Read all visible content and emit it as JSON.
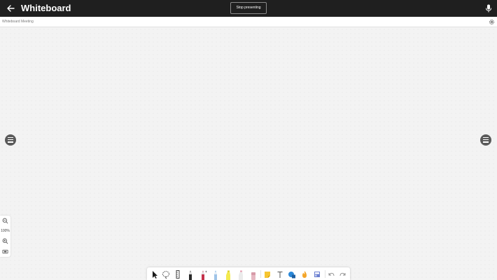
{
  "app": {
    "title": "Whiteboard",
    "stop_presenting_label": "Stop presenting",
    "meeting_name": "Whiteboard Meeting"
  },
  "zoom": {
    "level": "100%"
  },
  "icons": {
    "back": "arrow-left-icon",
    "mic": "microphone-icon",
    "settings": "gear-icon",
    "side_menu": "hamburger-menu-icon",
    "zoom_out": "zoom-out-icon",
    "zoom_in": "zoom-in-icon",
    "fit_view": "fit-to-screen-icon"
  },
  "toolbar": {
    "tools": [
      "select",
      "lasso",
      "ruler",
      "black-pen",
      "red-pen",
      "blue-pen",
      "yellow-highlighter",
      "pink-highlighter",
      "eraser",
      "sticky-note",
      "text",
      "shapes",
      "reactions",
      "templates",
      "undo",
      "redo"
    ]
  },
  "colors": {
    "topbar": "#1f1f1f",
    "canvas": "#f3f3f3",
    "accent_blue": "#2b88d8"
  }
}
